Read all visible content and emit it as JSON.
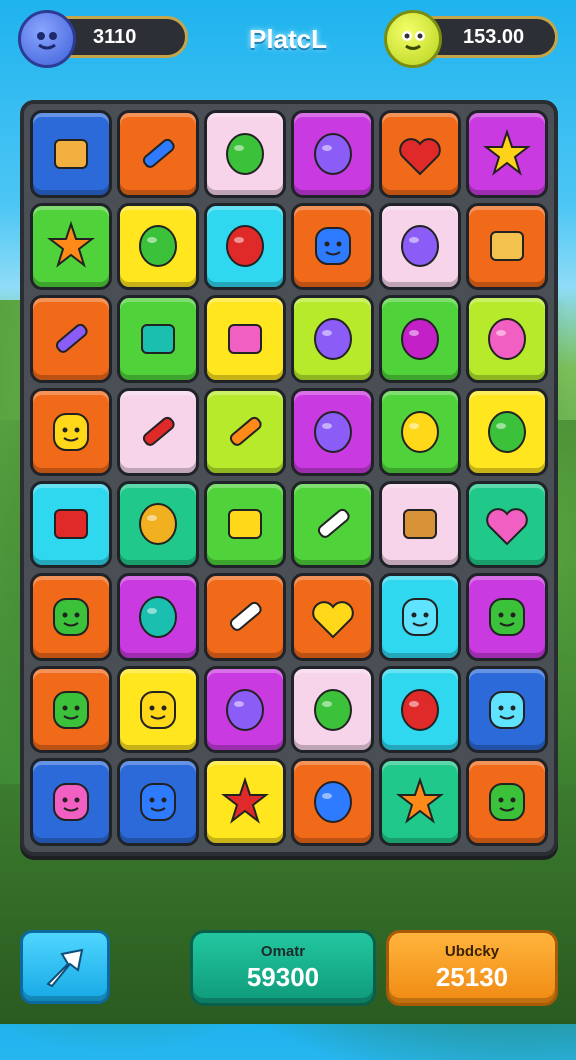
{
  "hud": {
    "left_score": "3110",
    "title": "PlatcL",
    "right_score": "153.00"
  },
  "bottom": {
    "left_label": "Omatr",
    "left_value": "59300",
    "right_label": "Ubdcky",
    "right_value": "25130"
  },
  "colors": {
    "blue": "#2b6ad8",
    "orange": "#f06a1a",
    "pink": "#f7d4ea",
    "magenta": "#c93ae0",
    "green": "#4fd23a",
    "yellow": "#ffe61e",
    "cyan": "#2fd7ef",
    "lime": "#b6ea2b",
    "teal": "#20c98a"
  },
  "board": [
    [
      {
        "bg": "blue",
        "icon": "smiling-block-icon"
      },
      {
        "bg": "orange",
        "icon": "blue-key-icon"
      },
      {
        "bg": "pink",
        "icon": "green-button-icon"
      },
      {
        "bg": "magenta",
        "icon": "purple-blob-icon"
      },
      {
        "bg": "orange",
        "icon": "red-heart-icon"
      },
      {
        "bg": "magenta",
        "icon": "sun-face-icon"
      }
    ],
    [
      {
        "bg": "green",
        "icon": "orange-star-icon"
      },
      {
        "bg": "yellow",
        "icon": "green-arch-icon"
      },
      {
        "bg": "cyan",
        "icon": "red-apple-icon"
      },
      {
        "bg": "orange",
        "icon": "blue-gumdrop-icon"
      },
      {
        "bg": "pink",
        "icon": "purple-gem-icon"
      },
      {
        "bg": "orange",
        "icon": "cheese-block-icon"
      }
    ],
    [
      {
        "bg": "orange",
        "icon": "purple-pencil-icon"
      },
      {
        "bg": "green",
        "icon": "teal-book-icon"
      },
      {
        "bg": "yellow",
        "icon": "pink-book-icon"
      },
      {
        "bg": "lime",
        "icon": "purple-bird-icon"
      },
      {
        "bg": "green",
        "icon": "magenta-berry-icon"
      },
      {
        "bg": "lime",
        "icon": "pink-balloon-icon"
      }
    ],
    [
      {
        "bg": "orange",
        "icon": "yellow-bear-icon"
      },
      {
        "bg": "pink",
        "icon": "red-carrot-icon"
      },
      {
        "bg": "lime",
        "icon": "orange-brush-icon"
      },
      {
        "bg": "magenta",
        "icon": "purple-rock-icon"
      },
      {
        "bg": "green",
        "icon": "yellow-drop-icon"
      },
      {
        "bg": "yellow",
        "icon": "green-shell-icon"
      }
    ],
    [
      {
        "bg": "cyan",
        "icon": "red-brick-icon"
      },
      {
        "bg": "teal",
        "icon": "gold-coin-icon"
      },
      {
        "bg": "green",
        "icon": "yellow-chip-icon"
      },
      {
        "bg": "green",
        "icon": "crossed-pencils-icon"
      },
      {
        "bg": "pink",
        "icon": "wood-block-icon"
      },
      {
        "bg": "teal",
        "icon": "pink-heart-icon"
      }
    ],
    [
      {
        "bg": "orange",
        "icon": "green-monster-icon"
      },
      {
        "bg": "magenta",
        "icon": "teal-gem-icon"
      },
      {
        "bg": "orange",
        "icon": "crossed-crayons-icon"
      },
      {
        "bg": "orange",
        "icon": "yellow-heart-icon"
      },
      {
        "bg": "cyan",
        "icon": "cyan-ghost-icon"
      },
      {
        "bg": "magenta",
        "icon": "green-hair-face-icon"
      }
    ],
    [
      {
        "bg": "orange",
        "icon": "green-monster-icon"
      },
      {
        "bg": "yellow",
        "icon": "yellow-sprout-icon"
      },
      {
        "bg": "magenta",
        "icon": "purple-radish-icon"
      },
      {
        "bg": "pink",
        "icon": "green-leaves-icon"
      },
      {
        "bg": "cyan",
        "icon": "red-lollipop-icon"
      },
      {
        "bg": "blue",
        "icon": "cyan-hat-face-icon"
      }
    ],
    [
      {
        "bg": "blue",
        "icon": "pink-capped-face-icon"
      },
      {
        "bg": "blue",
        "icon": "blue-drop-face-icon"
      },
      {
        "bg": "yellow",
        "icon": "red-burst-icon"
      },
      {
        "bg": "orange",
        "icon": "blue-balloon-icon"
      },
      {
        "bg": "teal",
        "icon": "orange-sun-icon"
      },
      {
        "bg": "orange",
        "icon": "green-capped-face-icon"
      }
    ]
  ]
}
